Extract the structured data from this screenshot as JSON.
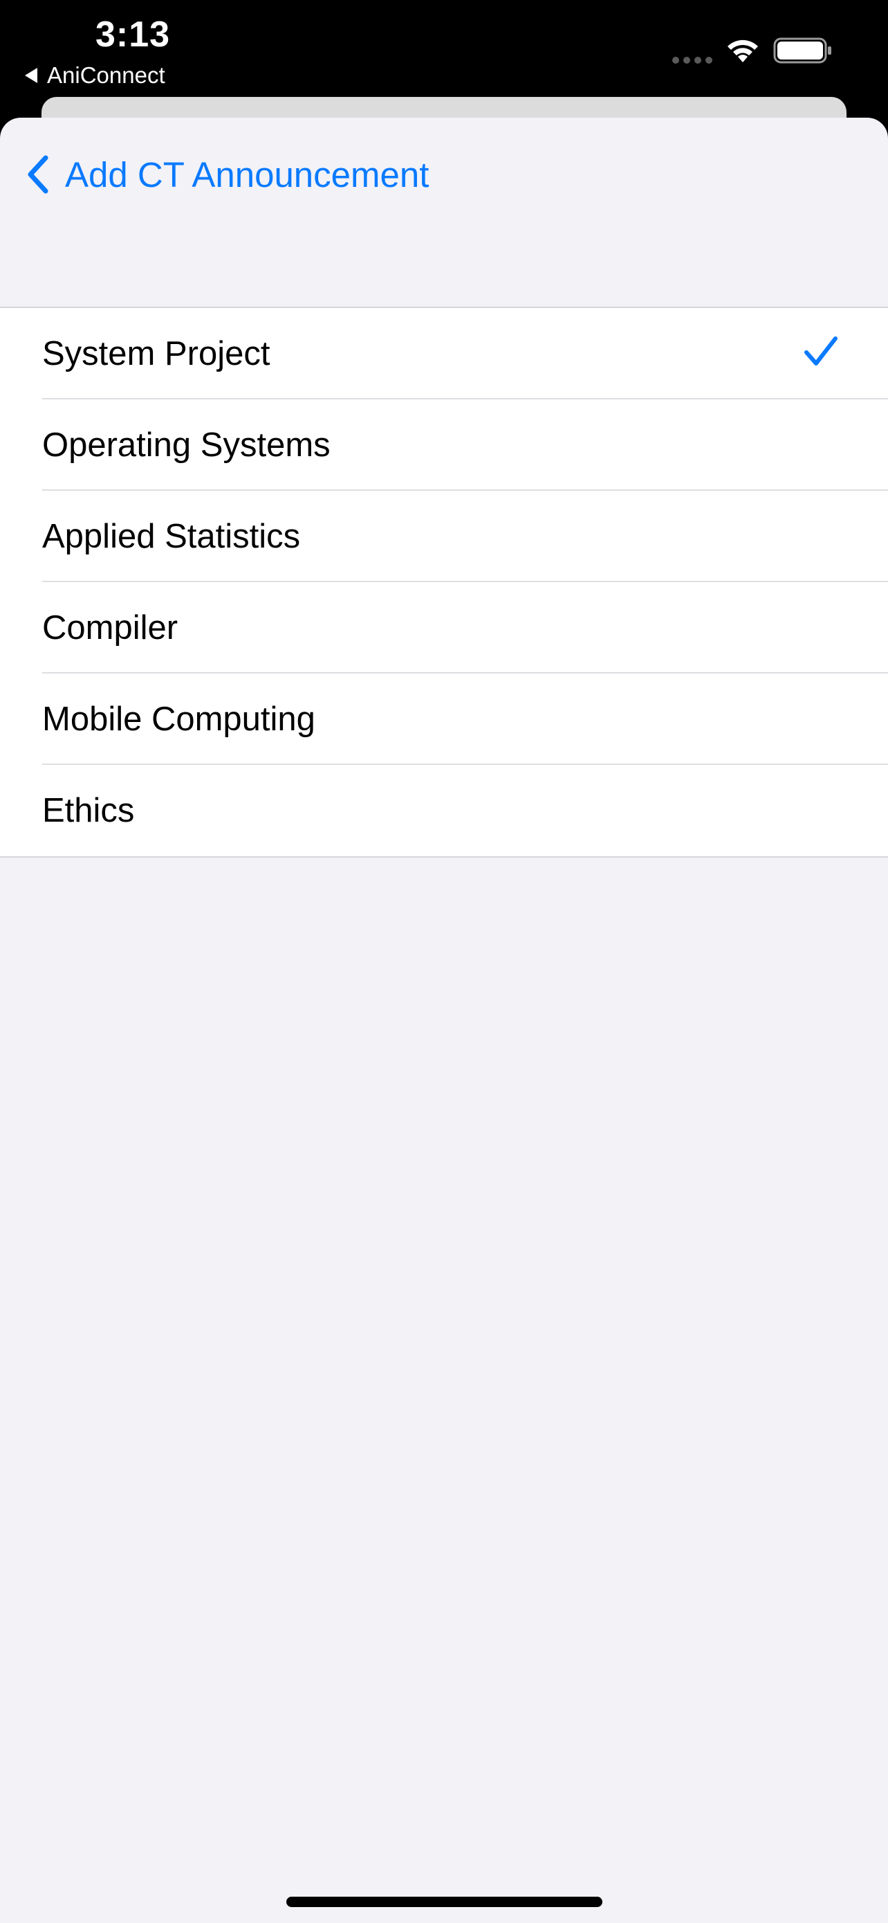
{
  "status_bar": {
    "time": "3:13",
    "back_app_label": "AniConnect",
    "wifi_icon": "wifi-icon",
    "battery_icon": "battery-icon"
  },
  "nav": {
    "back_label": "Add CT Announcement",
    "back_icon": "chevron-left-icon",
    "accent_color": "#0a7aff"
  },
  "options": [
    {
      "label": "System Project",
      "selected": true
    },
    {
      "label": "Operating Systems",
      "selected": false
    },
    {
      "label": "Applied Statistics",
      "selected": false
    },
    {
      "label": "Compiler",
      "selected": false
    },
    {
      "label": "Mobile Computing",
      "selected": false
    },
    {
      "label": "Ethics",
      "selected": false
    }
  ],
  "selected_icon": "checkmark-icon"
}
